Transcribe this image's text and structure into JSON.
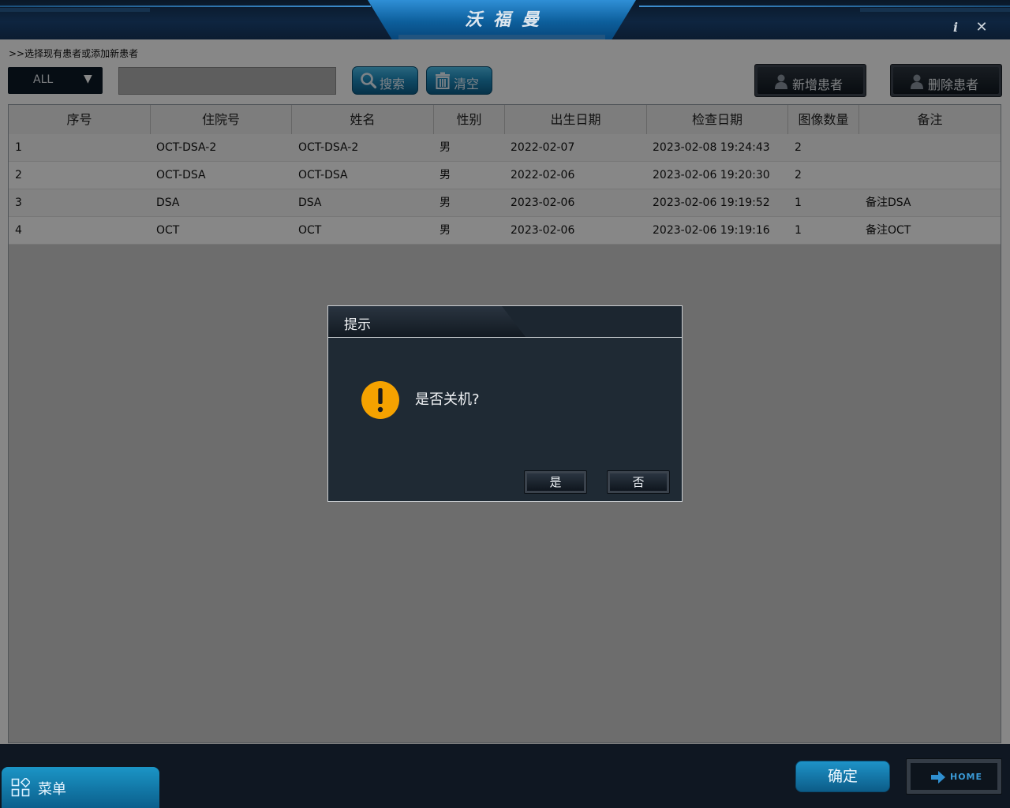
{
  "app": {
    "title": "沃福曼"
  },
  "window_controls": {
    "info": "i",
    "close": "✕"
  },
  "instruction": ">>选择现有患者或添加新患者",
  "filter": {
    "selected": "ALL",
    "arrow": "▼"
  },
  "search": {
    "value": "",
    "placeholder": ""
  },
  "toolbar": {
    "search_label": "搜索",
    "clear_label": "清空",
    "add_patient_label": "新增患者",
    "delete_patient_label": "删除患者"
  },
  "table": {
    "columns": [
      "序号",
      "住院号",
      "姓名",
      "性别",
      "出生日期",
      "检查日期",
      "图像数量",
      "备注"
    ],
    "rows": [
      [
        "1",
        "OCT-DSA-2",
        "OCT-DSA-2",
        "男",
        "2022-02-07",
        "2023-02-08 19:24:43",
        "2",
        ""
      ],
      [
        "2",
        "OCT-DSA",
        "OCT-DSA",
        "男",
        "2022-02-06",
        "2023-02-06 19:20:30",
        "2",
        ""
      ],
      [
        "3",
        "DSA",
        "DSA",
        "男",
        "2023-02-06",
        "2023-02-06 19:19:52",
        "1",
        "备注DSA"
      ],
      [
        "4",
        "OCT",
        "OCT",
        "男",
        "2023-02-06",
        "2023-02-06 19:19:16",
        "1",
        "备注OCT"
      ]
    ]
  },
  "bottom": {
    "menu_label": "菜单",
    "confirm_label": "确定",
    "home_label": "HOME"
  },
  "dialog": {
    "title": "提示",
    "message": "是否关机?",
    "yes_label": "是",
    "no_label": "否"
  },
  "colors": {
    "accent": "#1f8dc0",
    "warning": "#f5a200",
    "dark_bg": "#0f1722"
  },
  "icons": [
    "info-icon",
    "close-icon",
    "search-icon",
    "trash-icon",
    "user-icon",
    "grid-icon",
    "arrow-right-icon",
    "warning-icon"
  ]
}
